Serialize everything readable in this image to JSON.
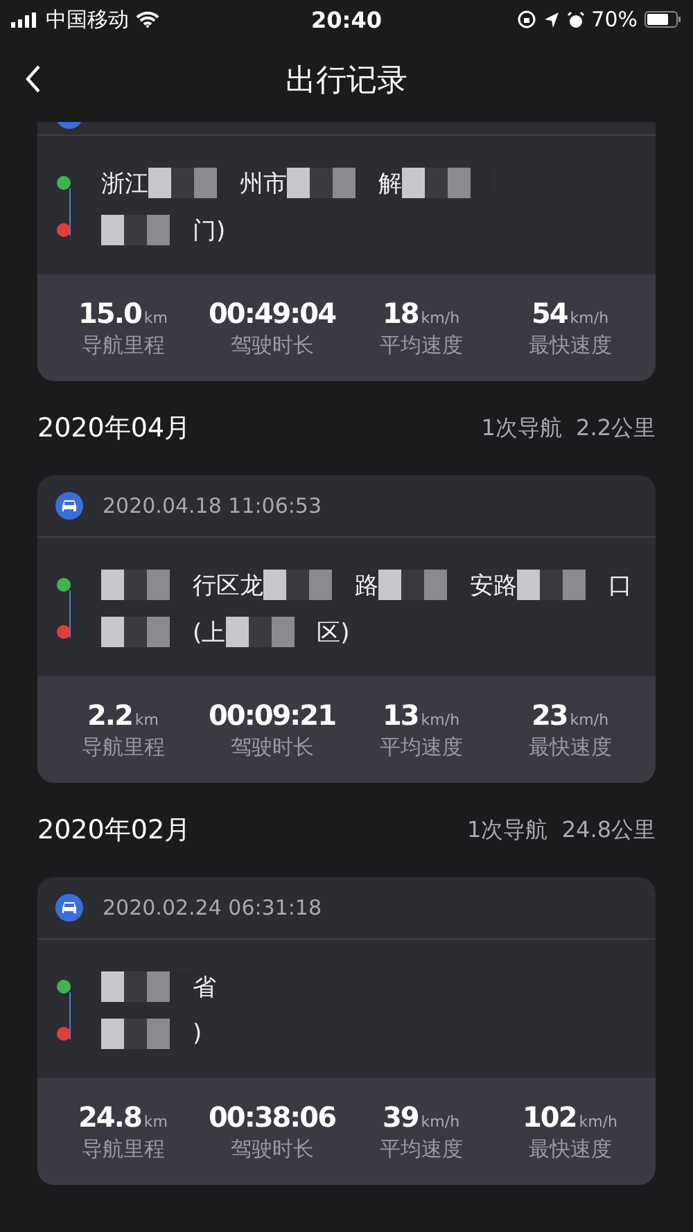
{
  "status_bar": {
    "carrier": "中国移动",
    "time": "20:40",
    "battery": "70%"
  },
  "nav": {
    "title": "出行记录"
  },
  "sections": [
    {
      "trips": [
        {
          "start": [
            {
              "kind": "text",
              "text": "浙江"
            },
            {
              "kind": "mosaic"
            },
            {
              "kind": "text",
              "text": "州市"
            },
            {
              "kind": "mosaic"
            },
            {
              "kind": "text",
              "text": "解"
            },
            {
              "kind": "mosaic"
            }
          ],
          "end": [
            {
              "kind": "mosaic"
            },
            {
              "kind": "text",
              "text": "门)"
            }
          ],
          "stats": [
            {
              "value": "15.0",
              "unit": "km",
              "label": "导航里程"
            },
            {
              "value": "00:49:04",
              "label": "驾驶时长"
            },
            {
              "value": "18",
              "unit": "km/h",
              "label": "平均速度"
            },
            {
              "value": "54",
              "unit": "km/h",
              "label": "最快速度"
            }
          ]
        }
      ]
    },
    {
      "month": "2020年04月",
      "summary": "1次导航  2.2公里",
      "trips": [
        {
          "date": "2020.04.18 11:06:53",
          "start": [
            {
              "kind": "mosaic"
            },
            {
              "kind": "text",
              "text": "行区龙"
            },
            {
              "kind": "mosaic"
            },
            {
              "kind": "text",
              "text": "路"
            },
            {
              "kind": "mosaic"
            },
            {
              "kind": "text",
              "text": "安路"
            },
            {
              "kind": "mosaic"
            },
            {
              "kind": "text",
              "text": "口"
            }
          ],
          "end": [
            {
              "kind": "mosaic"
            },
            {
              "kind": "text",
              "text": "(上"
            },
            {
              "kind": "mosaic"
            },
            {
              "kind": "text",
              "text": "区)"
            }
          ],
          "stats": [
            {
              "value": "2.2",
              "unit": "km",
              "label": "导航里程"
            },
            {
              "value": "00:09:21",
              "label": "驾驶时长"
            },
            {
              "value": "13",
              "unit": "km/h",
              "label": "平均速度"
            },
            {
              "value": "23",
              "unit": "km/h",
              "label": "最快速度"
            }
          ]
        }
      ]
    },
    {
      "month": "2020年02月",
      "summary": "1次导航  24.8公里",
      "trips": [
        {
          "date": "2020.02.24 06:31:18",
          "start": [
            {
              "kind": "mosaic"
            },
            {
              "kind": "text",
              "text": "省"
            }
          ],
          "end": [
            {
              "kind": "mosaic"
            },
            {
              "kind": "text",
              "text": ")"
            }
          ],
          "stats": [
            {
              "value": "24.8",
              "unit": "km",
              "label": "导航里程"
            },
            {
              "value": "00:38:06",
              "label": "驾驶时长"
            },
            {
              "value": "39",
              "unit": "km/h",
              "label": "平均速度"
            },
            {
              "value": "102",
              "unit": "km/h",
              "label": "最快速度"
            }
          ]
        }
      ]
    }
  ]
}
